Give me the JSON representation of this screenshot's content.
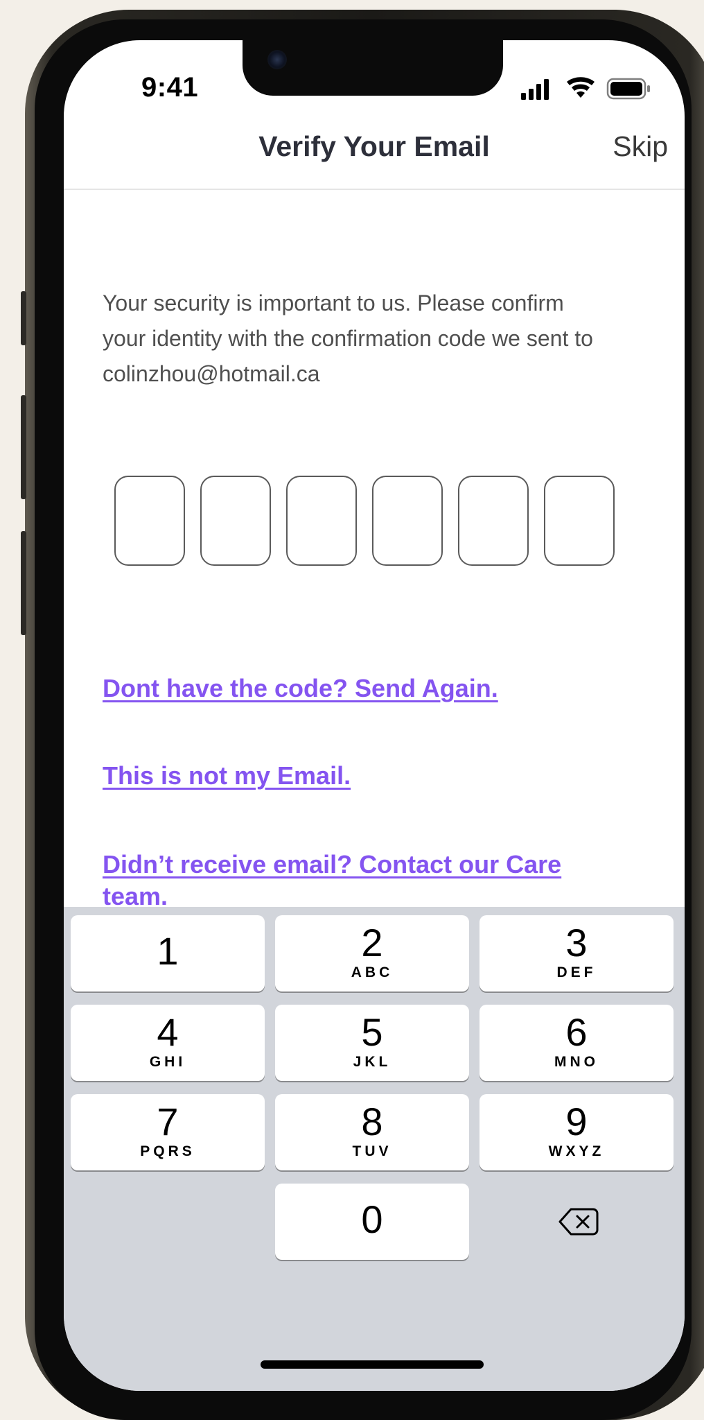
{
  "status_bar": {
    "time": "9:41"
  },
  "nav": {
    "title": "Verify Your Email",
    "skip_label": "Skip"
  },
  "intro_text": "Your security is important to us. Please confirm your identity with the confirmation code we sent to colinzhou@hotmail.ca",
  "code_boxes": [
    "",
    "",
    "",
    "",
    "",
    ""
  ],
  "links": {
    "send_again": "Dont have the code? Send Again.",
    "not_my_email": "This is not my Email.",
    "contact_care": "Didn’t receive email? Contact our Care team."
  },
  "keypad": [
    {
      "digit": "1",
      "letters": ""
    },
    {
      "digit": "2",
      "letters": "ABC"
    },
    {
      "digit": "3",
      "letters": "DEF"
    },
    {
      "digit": "4",
      "letters": "GHI"
    },
    {
      "digit": "5",
      "letters": "JKL"
    },
    {
      "digit": "6",
      "letters": "MNO"
    },
    {
      "digit": "7",
      "letters": "PQRS"
    },
    {
      "digit": "8",
      "letters": "TUV"
    },
    {
      "digit": "9",
      "letters": "WXYZ"
    },
    {
      "digit": "0",
      "letters": ""
    }
  ],
  "icons": {
    "signal": "cellular-signal-icon",
    "wifi": "wifi-icon",
    "battery": "battery-icon",
    "backspace": "backspace-icon"
  },
  "colors": {
    "link": "#8454f0",
    "keyboard_bg": "#d2d5db",
    "title": "#2d2f3a"
  }
}
